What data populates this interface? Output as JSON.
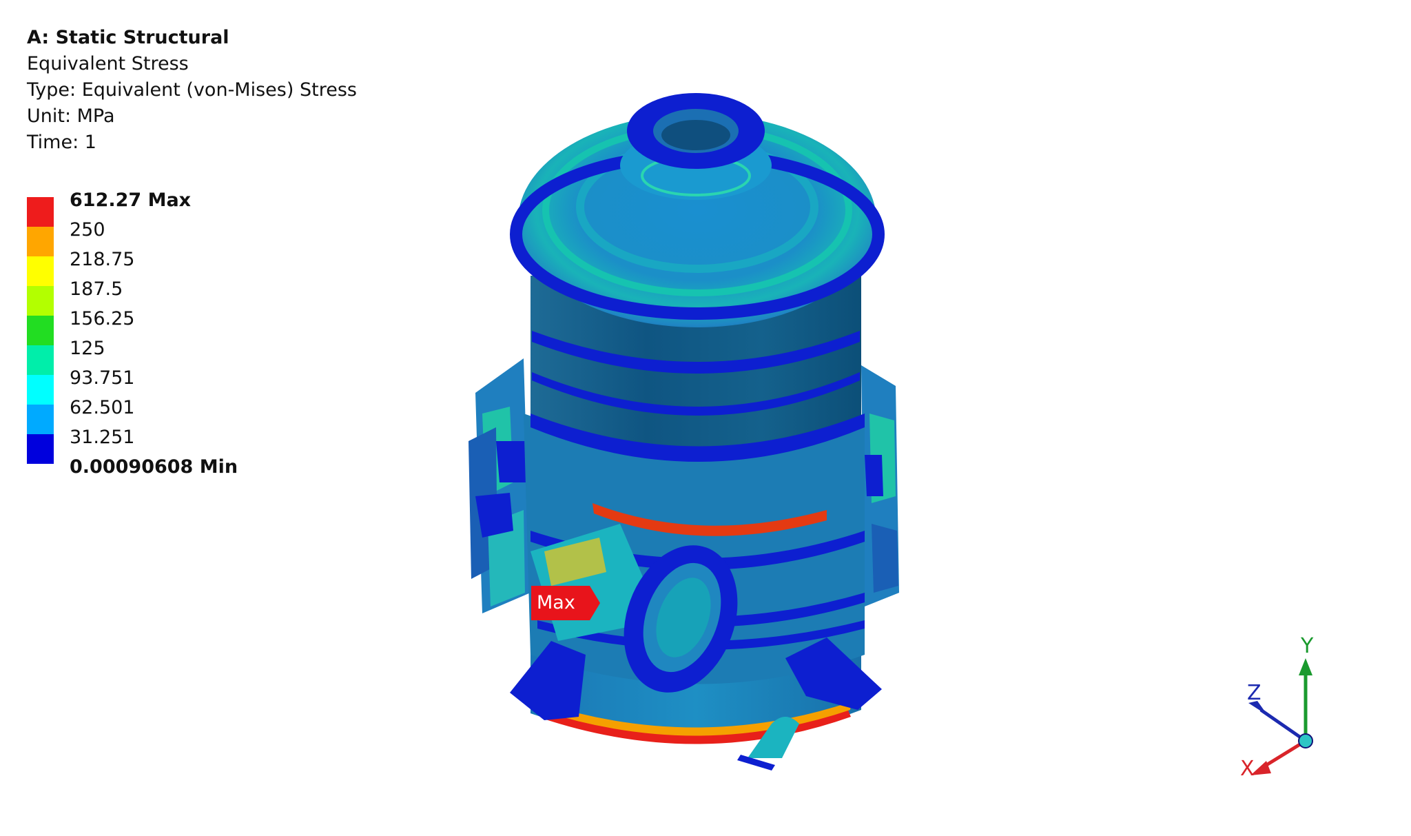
{
  "header": {
    "title": "A: Static Structural",
    "result_name": "Equivalent Stress",
    "type_line": "Type: Equivalent (von-Mises) Stress",
    "unit_line": "Unit: MPa",
    "time_line": "Time: 1"
  },
  "legend": {
    "labels": [
      "612.27 Max",
      "250",
      "218.75",
      "187.5",
      "156.25",
      "125",
      "93.751",
      "62.501",
      "31.251",
      "0.00090608 Min"
    ],
    "colors": [
      "#ee1c1c",
      "#ffa600",
      "#ffff00",
      "#b3ff00",
      "#22dd22",
      "#00eeaa",
      "#00ffff",
      "#00aaff",
      "#0000dd"
    ]
  },
  "probe": {
    "max_label": "Max",
    "color": "#e8141b"
  },
  "triad": {
    "x_label": "X",
    "y_label": "Y",
    "z_label": "Z",
    "x_color": "#d9242a",
    "y_color": "#1a9a2e",
    "z_color": "#1c2ab0"
  }
}
